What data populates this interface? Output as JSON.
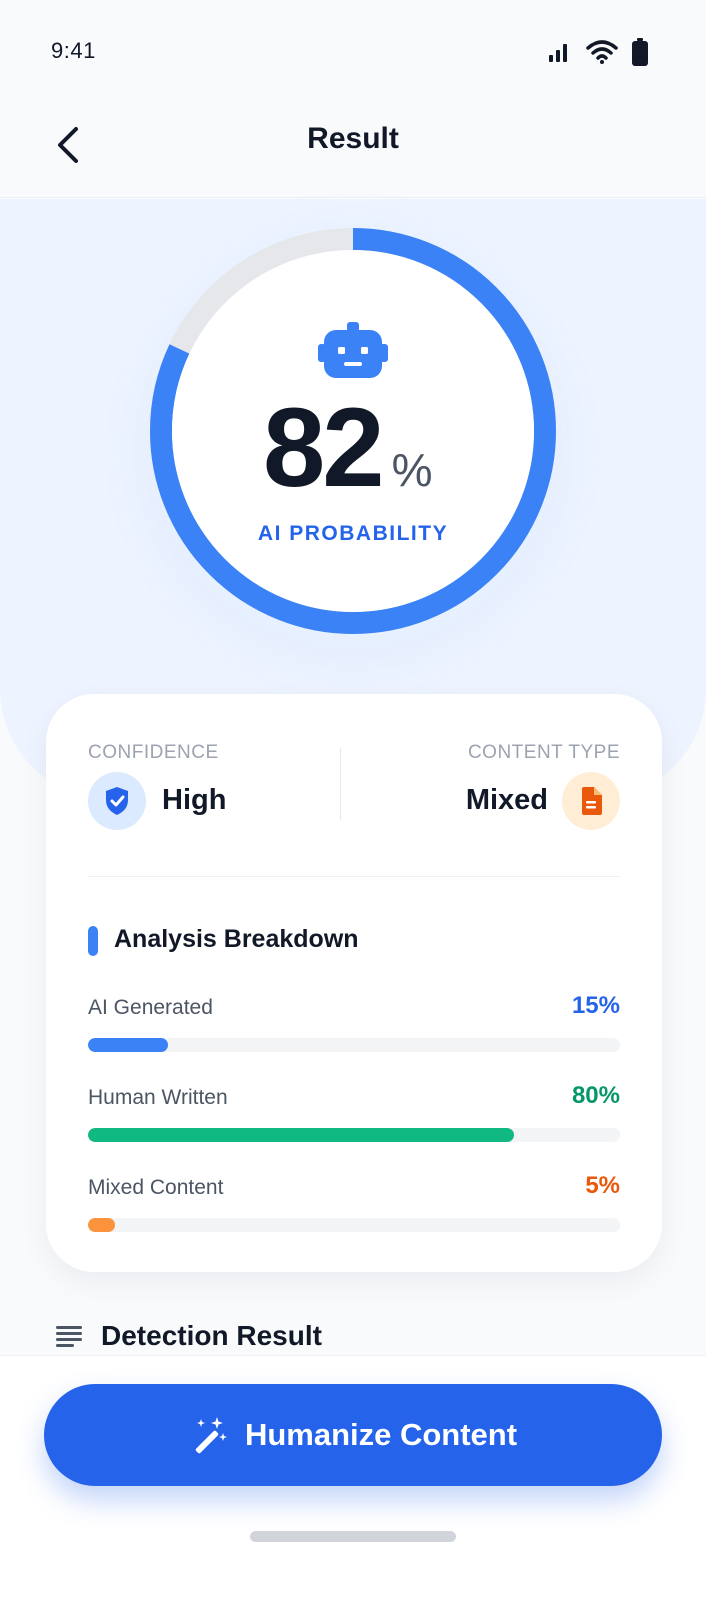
{
  "status_bar": {
    "time": "9:41",
    "icons": [
      "signal-icon",
      "wifi-icon",
      "battery-icon"
    ]
  },
  "nav": {
    "title": "Result",
    "back_icon": "chevron-left-icon"
  },
  "score": {
    "value": "82",
    "unit": "%",
    "label": "AI PROBABILITY",
    "fraction": 0.82,
    "icon": "robot-icon",
    "colors": {
      "progress": "#3b82f6",
      "track": "#e5e7eb"
    }
  },
  "summary": {
    "confidence": {
      "label": "CONFIDENCE",
      "value": "High",
      "icon": "shield-check-icon"
    },
    "content_type": {
      "label": "CONTENT TYPE",
      "value": "Mixed",
      "icon": "document-icon"
    }
  },
  "breakdown": {
    "title": "Analysis Breakdown",
    "items": [
      {
        "label": "AI Generated",
        "value": "15%",
        "fraction": 0.15,
        "color": "#2563eb",
        "bar_color": "#3b82f6"
      },
      {
        "label": "Human Written",
        "value": "80%",
        "fraction": 0.8,
        "color": "#059669",
        "bar_color": "#10b981"
      },
      {
        "label": "Mixed Content",
        "value": "5%",
        "fraction": 0.05,
        "color": "#ea580c",
        "bar_color": "#fb923c"
      }
    ]
  },
  "detection": {
    "title": "Detection Result",
    "icon": "text-lines-icon"
  },
  "cta": {
    "label": "Humanize Content",
    "icon": "magic-wand-icon"
  },
  "colors": {
    "primary": "#2563eb",
    "background": "#f8fafc",
    "hero": "#eef4ff"
  }
}
